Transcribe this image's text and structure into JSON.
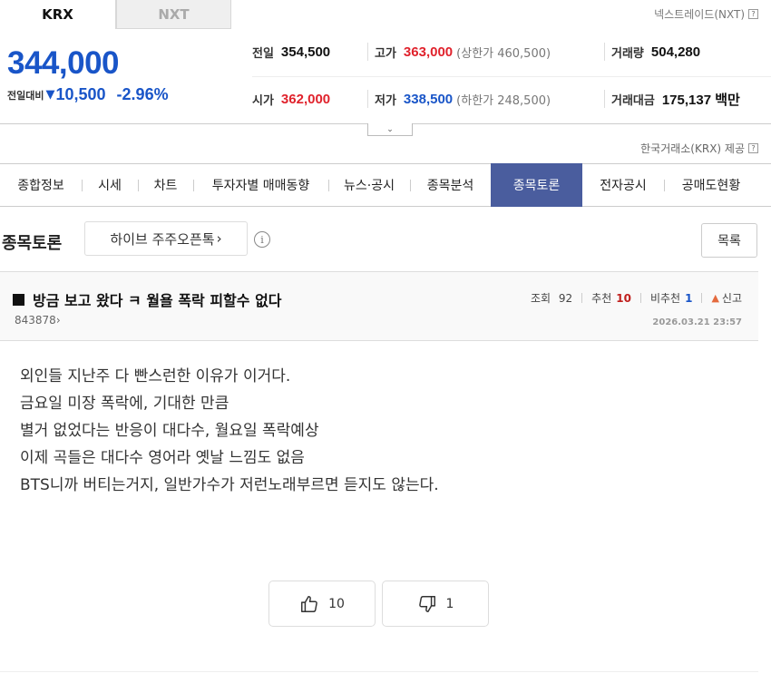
{
  "market_tabs": [
    {
      "label": "KRX",
      "active": true
    },
    {
      "label": "NXT",
      "active": false
    }
  ],
  "nxt_link": "넥스트레이드(NXT)",
  "quote": {
    "price": "344,000",
    "change_label": "전일대비",
    "change_amount": "10,500",
    "change_direction": "down",
    "change_percent": "-2.96%",
    "color_down": "#1955c8",
    "color_up": "#e0222c"
  },
  "stats": {
    "prev_close": {
      "label": "전일",
      "value": "354,500"
    },
    "high": {
      "label": "고가",
      "value": "363,000",
      "limit": "(상한가 460,500)"
    },
    "volume": {
      "label": "거래량",
      "value": "504,280"
    },
    "open": {
      "label": "시가",
      "value": "362,000"
    },
    "low": {
      "label": "저가",
      "value": "338,500",
      "limit": "(하한가 248,500)"
    },
    "trade_value": {
      "label": "거래대금",
      "value": "175,137 백만"
    }
  },
  "source": "한국거래소(KRX) 제공",
  "nav_tabs": [
    {
      "label": "종합정보"
    },
    {
      "label": "시세"
    },
    {
      "label": "차트"
    },
    {
      "label": "투자자별 매매동향"
    },
    {
      "label": "뉴스·공시"
    },
    {
      "label": "종목분석"
    },
    {
      "label": "종목토론",
      "active": true
    },
    {
      "label": "전자공시"
    },
    {
      "label": "공매도현황"
    }
  ],
  "board": {
    "title": "종목토론",
    "opentalk_label": "하이브 주주오픈톡",
    "list_button": "목록"
  },
  "post": {
    "title": "방금 보고 왔다 ㅋ 월욜 폭락 피할수 없다",
    "author": "843878",
    "views_label": "조회",
    "views": "92",
    "likes_label": "추천",
    "likes": "10",
    "dislikes_label": "비추천",
    "dislikes": "1",
    "report_label": "신고",
    "date": "2026.03.21 23:57",
    "body": [
      "외인들 지난주 다 빤스런한 이유가 이거다.",
      "금요일 미장 폭락에, 기대한 만큼",
      "별거 없었다는 반응이 대다수, 월요일 폭락예상",
      "이제 곡들은 대다수 영어라 옛날 느낌도 없음",
      "BTS니까 버티는거지, 일반가수가 저런노래부르면 듣지도 않는다."
    ]
  },
  "votes": {
    "up": "10",
    "down": "1"
  },
  "accent_nav_active": "#4a5d9e"
}
